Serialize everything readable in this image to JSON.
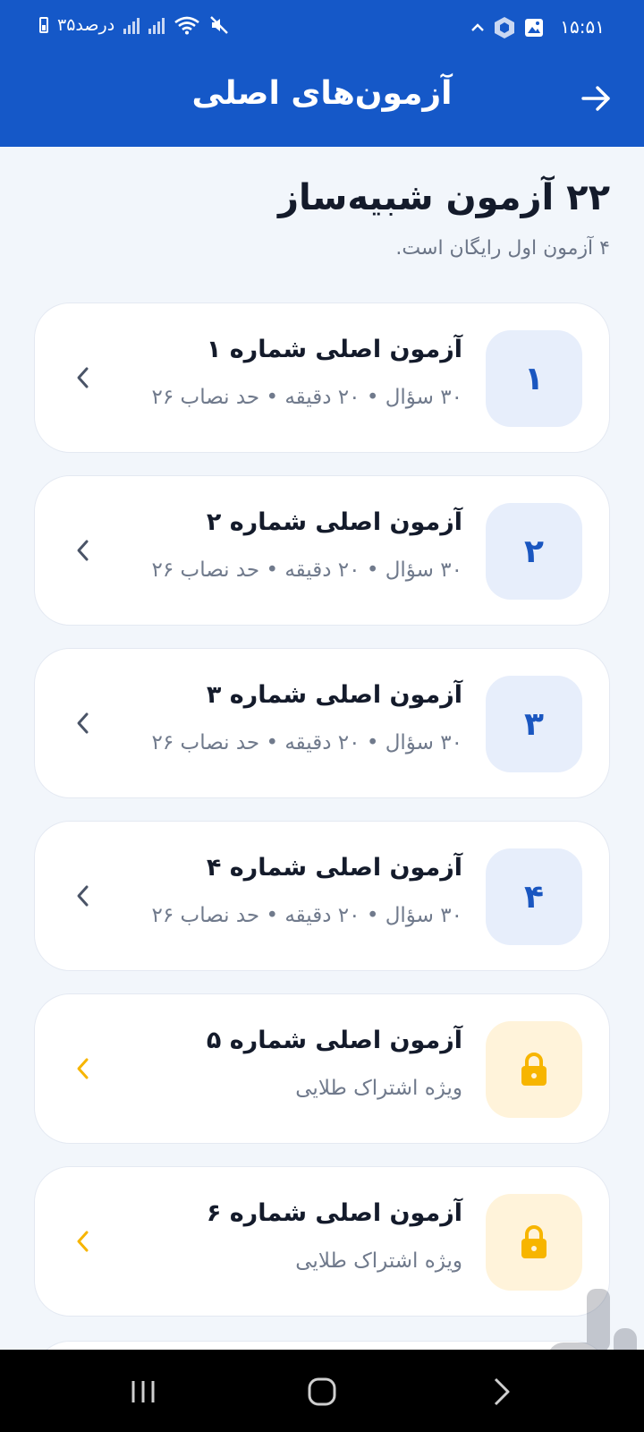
{
  "status_bar": {
    "time": "۱۵:۵۱",
    "battery_text": "۳۵درصد"
  },
  "app_bar": {
    "title": "آزمون‌های اصلی"
  },
  "header": {
    "title": "۲۲ آزمون شبیه‌ساز",
    "subtitle": "۴ آزمون اول رایگان است."
  },
  "exams": [
    {
      "badge": "۱",
      "title": "آزمون اصلی شماره ۱",
      "meta": "۳۰ سؤال • ۲۰ دقیقه • حد نصاب ۲۶",
      "locked": false
    },
    {
      "badge": "۲",
      "title": "آزمون اصلی شماره ۲",
      "meta": "۳۰ سؤال • ۲۰ دقیقه • حد نصاب ۲۶",
      "locked": false
    },
    {
      "badge": "۳",
      "title": "آزمون اصلی شماره ۳",
      "meta": "۳۰ سؤال • ۲۰ دقیقه • حد نصاب ۲۶",
      "locked": false
    },
    {
      "badge": "۴",
      "title": "آزمون اصلی شماره ۴",
      "meta": "۳۰ سؤال • ۲۰ دقیقه • حد نصاب ۲۶",
      "locked": false
    },
    {
      "badge": "lock-icon",
      "title": "آزمون اصلی شماره ۵",
      "meta": "ویژه اشتراک طلایی",
      "locked": true
    },
    {
      "badge": "lock-icon",
      "title": "آزمون اصلی شماره ۶",
      "meta": "ویژه اشتراک طلایی",
      "locked": true
    }
  ],
  "colors": {
    "primary": "#1558c8",
    "badge_bg": "#e7eefb",
    "locked_bg": "#fff3da",
    "gold": "#f7b500"
  }
}
